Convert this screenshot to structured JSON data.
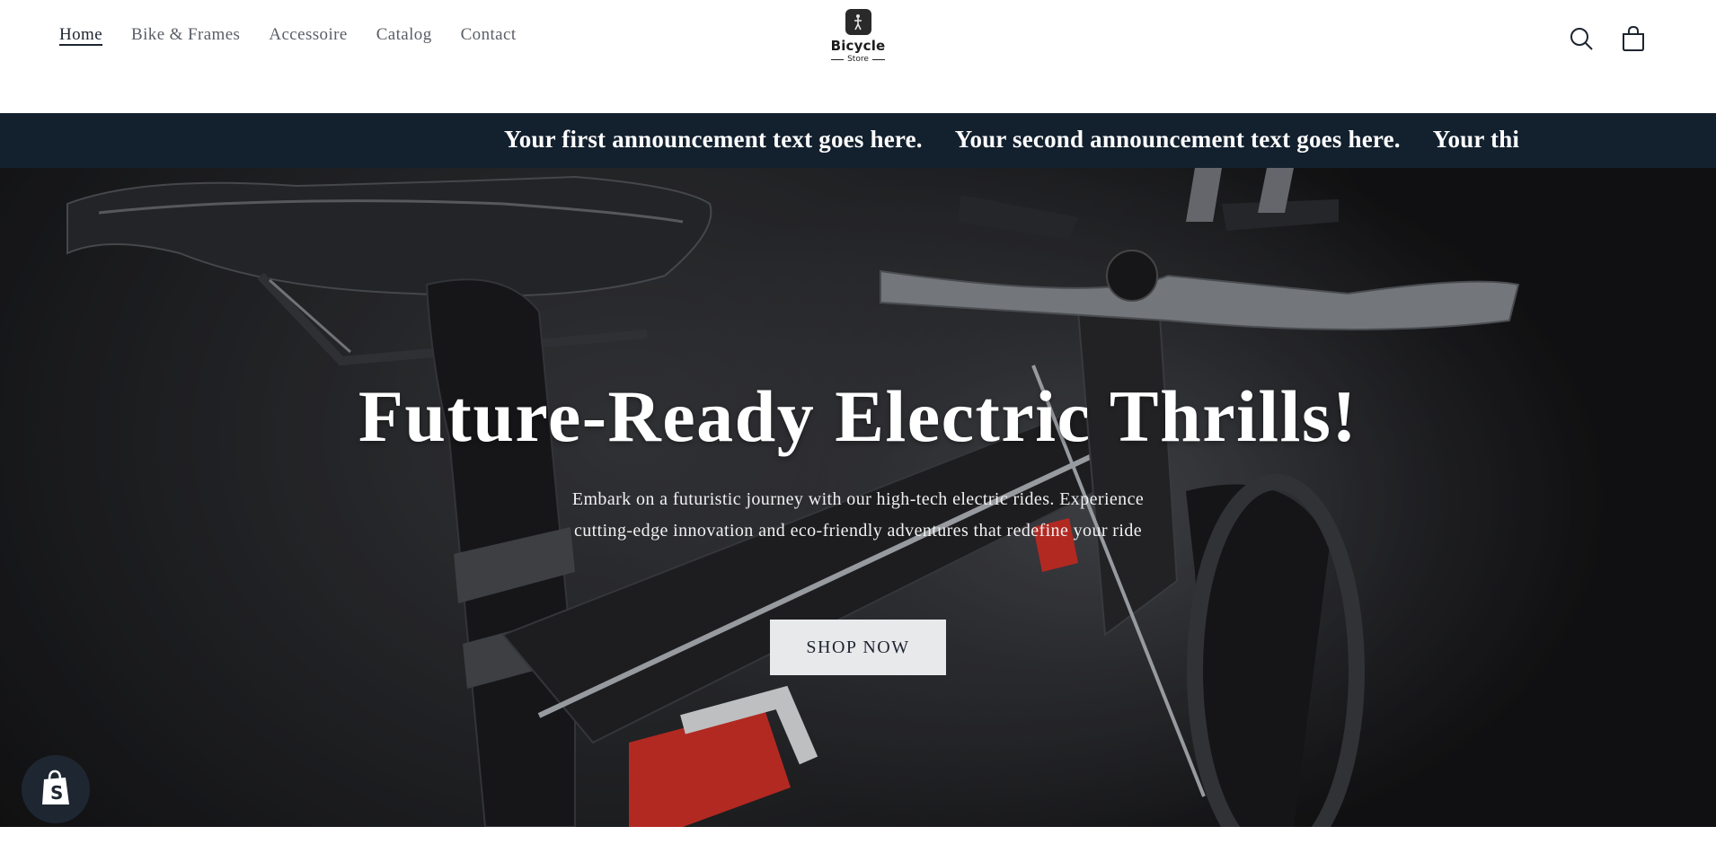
{
  "nav": {
    "items": [
      "Home",
      "Bike & Frames",
      "Accessoire",
      "Catalog",
      "Contact"
    ]
  },
  "logo": {
    "title": "Bicycle",
    "subtitle": "Store"
  },
  "announcements": [
    "Your first announcement text goes here.",
    "Your second announcement text goes here.",
    "Your thi"
  ],
  "hero": {
    "title": "Future-Ready Electric Thrills!",
    "description": "Embark on a futuristic journey with our high-tech electric rides. Experience cutting-edge innovation and eco-friendly adventures that redefine your ride",
    "button_label": "SHOP NOW"
  },
  "colors": {
    "announcement_bg": "#13202e",
    "button_bg": "#e8e9eb",
    "accent_red": "#d9332a"
  },
  "icons": [
    "search-icon",
    "cart-icon",
    "shopify-bag-icon"
  ]
}
